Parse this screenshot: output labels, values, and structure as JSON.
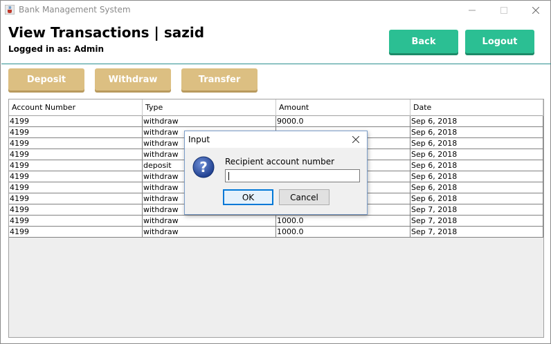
{
  "window": {
    "title": "Bank Management System",
    "icon": "java-cup-icon"
  },
  "header": {
    "title": "View Transactions | sazid",
    "logged_in": "Logged in as: Admin",
    "back_label": "Back",
    "logout_label": "Logout"
  },
  "actions": {
    "deposit_label": "Deposit",
    "withdraw_label": "Withdraw",
    "transfer_label": "Transfer"
  },
  "table": {
    "columns": [
      "Account Number",
      "Type",
      "Amount",
      "Date"
    ],
    "rows": [
      [
        "4199",
        "withdraw",
        "9000.0",
        "Sep 6, 2018"
      ],
      [
        "4199",
        "withdraw",
        "",
        "Sep 6, 2018"
      ],
      [
        "4199",
        "withdraw",
        "",
        "Sep 6, 2018"
      ],
      [
        "4199",
        "withdraw",
        "",
        "Sep 6, 2018"
      ],
      [
        "4199",
        "deposit",
        "",
        "Sep 6, 2018"
      ],
      [
        "4199",
        "withdraw",
        "",
        "Sep 6, 2018"
      ],
      [
        "4199",
        "withdraw",
        "",
        "Sep 6, 2018"
      ],
      [
        "4199",
        "withdraw",
        "",
        "Sep 6, 2018"
      ],
      [
        "4199",
        "withdraw",
        "",
        "Sep 7, 2018"
      ],
      [
        "4199",
        "withdraw",
        "1000.0",
        "Sep 7, 2018"
      ],
      [
        "4199",
        "withdraw",
        "1000.0",
        "Sep 7, 2018"
      ]
    ]
  },
  "dialog": {
    "title": "Input",
    "label": "Recipient account number",
    "input_value": "",
    "ok_label": "OK",
    "cancel_label": "Cancel",
    "icon": "question-icon"
  },
  "colors": {
    "accent_green": "#2bbf93",
    "accent_tan": "#dcbf82",
    "header_line": "#2a8f8f"
  }
}
